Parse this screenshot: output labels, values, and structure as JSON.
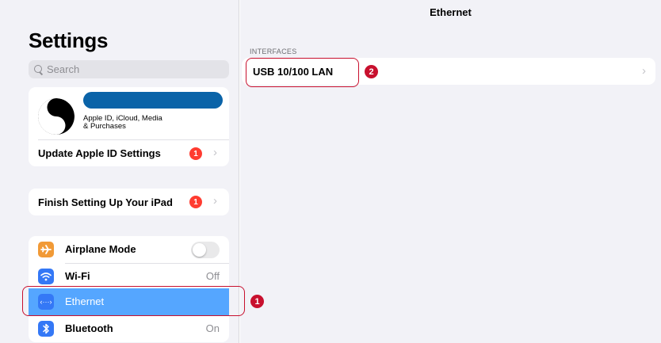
{
  "sidebar": {
    "title": "Settings",
    "search_placeholder": "Search",
    "profile": {
      "subtitle": "Apple ID, iCloud, Media\n& Purchases",
      "update_label": "Update Apple ID Settings",
      "update_badge": "1"
    },
    "finish": {
      "label": "Finish Setting Up Your iPad",
      "badge": "1"
    },
    "network_items": [
      {
        "label": "Airplane Mode",
        "value": "",
        "icon": "airplane-icon",
        "color": "#f19a37"
      },
      {
        "label": "Wi-Fi",
        "value": "Off",
        "icon": "wifi-icon",
        "color": "#3478f6"
      },
      {
        "label": "Ethernet",
        "value": "",
        "icon": "ethernet-icon",
        "color": "#3478f6"
      },
      {
        "label": "Bluetooth",
        "value": "On",
        "icon": "bluetooth-icon",
        "color": "#3478f6"
      }
    ],
    "airplane_toggle_on": false
  },
  "main": {
    "title": "Ethernet",
    "section_header": "INTERFACES",
    "interfaces": [
      {
        "label": "USB 10/100 LAN"
      }
    ]
  },
  "annotations": [
    {
      "number": "1",
      "target": "Ethernet"
    },
    {
      "number": "2",
      "target": "USB 10/100 LAN"
    }
  ],
  "colors": {
    "accent_selected": "#55a6ff",
    "badge": "#ff3b30",
    "annotation": "#c8102e"
  }
}
